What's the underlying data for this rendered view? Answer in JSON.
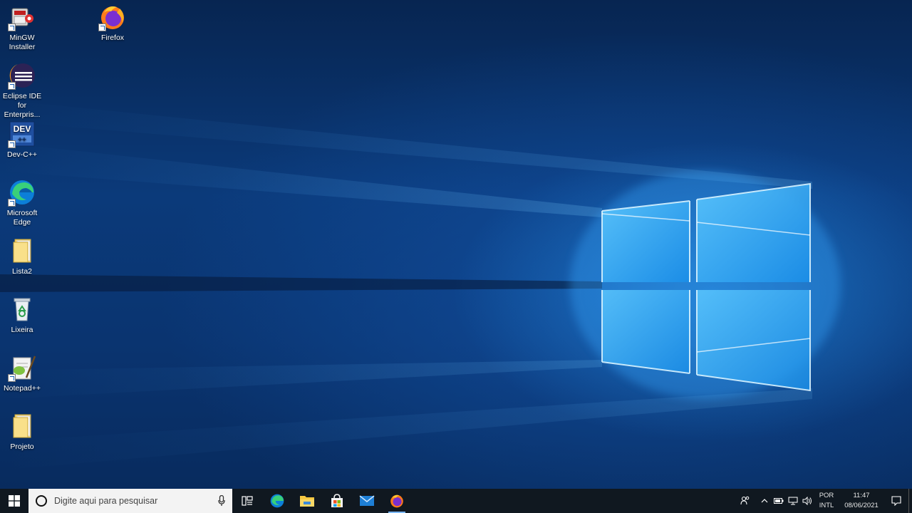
{
  "desktop": {
    "icons": [
      {
        "label": "MinGW Installer"
      },
      {
        "label": "Firefox"
      },
      {
        "label": "Eclipse IDE for Enterpris..."
      },
      {
        "label": "Dev-C++"
      },
      {
        "label": "Microsoft Edge"
      },
      {
        "label": "Lista2"
      },
      {
        "label": "Lixeira"
      },
      {
        "label": "Notepad++"
      },
      {
        "label": "Projeto"
      }
    ]
  },
  "taskbar": {
    "search_placeholder": "Digite aqui para pesquisar",
    "pinned_apps": [
      "task-view",
      "microsoft-edge",
      "file-explorer",
      "microsoft-store",
      "mail",
      "firefox"
    ],
    "active_app": "firefox",
    "language_line1": "POR",
    "language_line2": "INTL",
    "time": "11:47",
    "date": "08/06/2021"
  },
  "colors": {
    "accent": "#1e90ff",
    "taskbar_bg": "#101820",
    "search_bg": "#f3f3f3"
  }
}
